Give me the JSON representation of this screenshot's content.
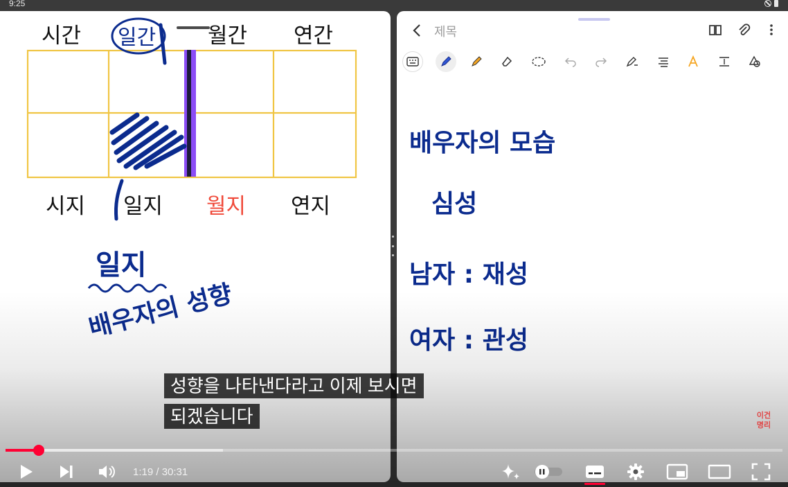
{
  "status_bar": {
    "time": "9:25"
  },
  "note_app": {
    "title": "제목",
    "toolbar": [
      "keyboard-mode",
      "pen",
      "highlighter",
      "eraser",
      "lasso",
      "undo",
      "redo",
      "pen-settings",
      "text-align",
      "text-style",
      "spacing",
      "shapes"
    ]
  },
  "board": {
    "top_labels": [
      "시간",
      "일간",
      "월간",
      "연간"
    ],
    "bottom_labels": [
      "시지",
      "일지",
      "월지",
      "연지"
    ],
    "notes": [
      "일지",
      "배우자의 성향"
    ],
    "colors": {
      "grid": "#f0c543",
      "ink": "#0b2b8e",
      "accent_red": "#f04a3a",
      "divider": "#8b4cf6"
    }
  },
  "right_notes": [
    "배우자의 모습",
    "심성",
    "남자 : 재성",
    "여자 : 관성"
  ],
  "video": {
    "caption_line1": "성향을 나타낸다라고 이제 보시면",
    "caption_line2": "되겠습니다",
    "time_display": "1:19 / 30:31",
    "progress_played": 0.043,
    "progress_loaded": 0.28,
    "channel_mark": [
      "이건",
      "명리"
    ]
  }
}
